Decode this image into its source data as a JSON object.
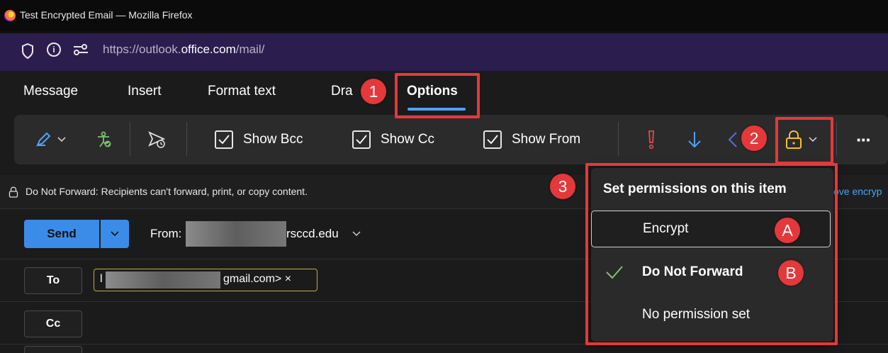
{
  "window": {
    "title": "Test Encrypted Email — Mozilla Firefox"
  },
  "address_bar": {
    "url_prefix": "https://outlook.",
    "url_domain": "office.com",
    "url_suffix": "/mail/"
  },
  "tabs": [
    {
      "label": "Message"
    },
    {
      "label": "Insert"
    },
    {
      "label": "Format text"
    },
    {
      "label": "Dra"
    },
    {
      "label": "Options",
      "active": true
    }
  ],
  "ribbon": {
    "show_bcc": "Show Bcc",
    "show_cc": "Show Cc",
    "show_from": "Show From",
    "more": "···"
  },
  "info_bar": {
    "text": "Do Not Forward: Recipients can't forward, print, or copy content.",
    "trailing_link": "ove encryp"
  },
  "compose": {
    "send_label": "Send",
    "from_label": "From:",
    "from_address_visible": "rsccd.edu",
    "to_label": "To",
    "cc_label": "Cc",
    "to_recipient_prefix": "l",
    "to_recipient_visible": "gmail.com>",
    "remove_recipient": "×"
  },
  "permissions_menu": {
    "header": "Set permissions on this item",
    "options": [
      {
        "label": "Encrypt",
        "focused": true,
        "checked": false
      },
      {
        "label": "Do Not Forward",
        "focused": false,
        "checked": true
      },
      {
        "label": "No permission set",
        "focused": false,
        "checked": false
      }
    ]
  },
  "annotations": {
    "step1": "1",
    "step2": "2",
    "step3": "3",
    "label_a": "A",
    "label_b": "B",
    "color": "#e5383b"
  },
  "colors": {
    "accent": "#3b8ce8",
    "url_bar": "#2b1e4e",
    "lock_icon": "#f2c230",
    "check": "#7cc36e",
    "importance_icon": "#e54b4b"
  }
}
